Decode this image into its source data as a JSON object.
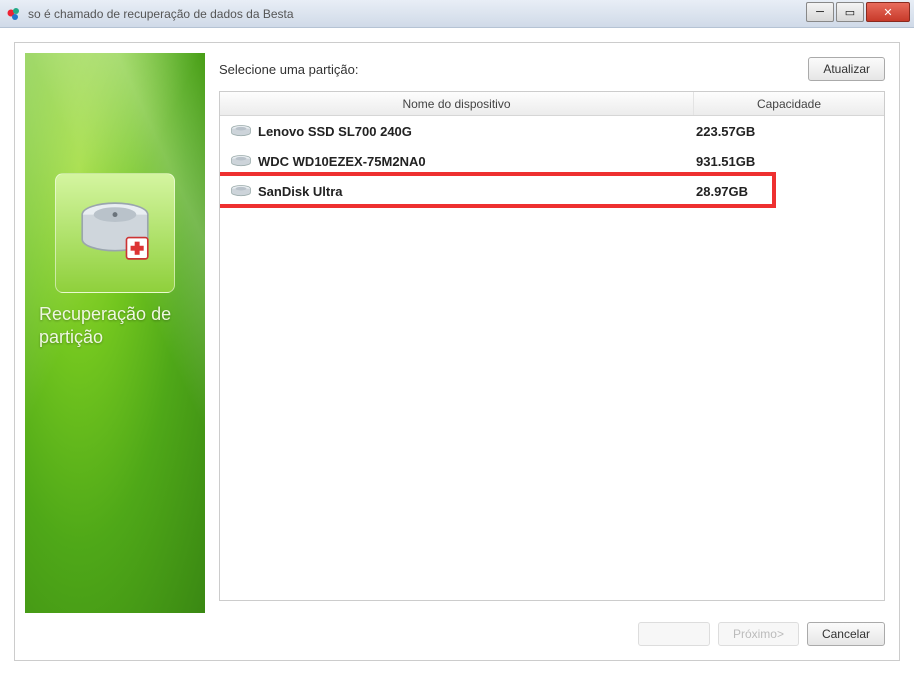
{
  "window": {
    "title": "so é chamado de recuperação de dados da Besta"
  },
  "sidebar": {
    "mode_label": "Recuperação de partição"
  },
  "main": {
    "instruction": "Selecione uma partição:",
    "refresh_label": "Atualizar",
    "columns": {
      "name": "Nome do dispositivo",
      "capacity": "Capacidade"
    },
    "devices": [
      {
        "name": "Lenovo SSD SL700 240G",
        "capacity": "223.57GB",
        "highlighted": false
      },
      {
        "name": "WDC WD10EZEX-75M2NA0",
        "capacity": "931.51GB",
        "highlighted": false
      },
      {
        "name": "SanDisk Ultra",
        "capacity": "28.97GB",
        "highlighted": true
      }
    ]
  },
  "footer": {
    "back_label": "",
    "next_label": "Próximo>",
    "cancel_label": "Cancelar"
  }
}
